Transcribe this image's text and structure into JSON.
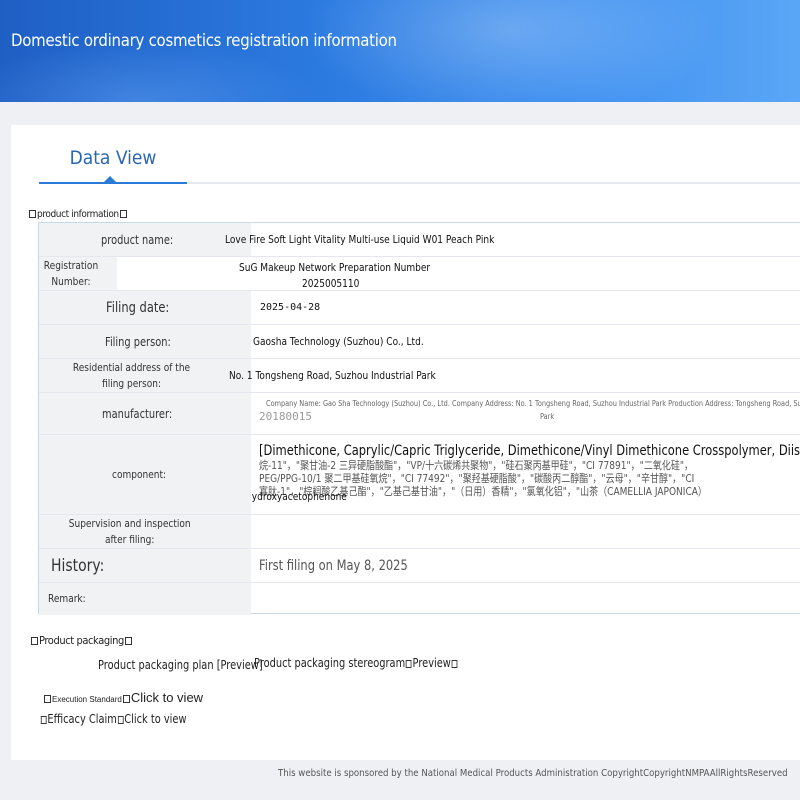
{
  "header": {
    "title": "Domestic ordinary cosmetics registration information"
  },
  "tabs": [
    {
      "label": "Data View"
    }
  ],
  "sections": {
    "product_information": "product information",
    "product_packaging": "Product packaging"
  },
  "info": {
    "product_name_label": "product name:",
    "product_name": "Love Fire Soft Light Vitality Multi-use Liquid W01 Peach Pink",
    "reg_number_label": "Registration Number:",
    "reg_number_line1": "SuG Makeup Network Preparation Number",
    "reg_number_line2": "2025005110",
    "filing_date_label": "Filing date:",
    "filing_date": "2025-04-28",
    "filing_person_label": "Filing person:",
    "filing_person": "Gaosha Technology (Suzhou) Co., Ltd.",
    "address_label": "Residential address of the filing person:",
    "address": "No. 1 Tongsheng Road, Suzhou Industrial Park",
    "manufacturer_label": "manufacturer:",
    "manufacturer_line1": "Company Name: Gao Sha Technology (Suzhou) Co., Ltd. Company Address: No. 1 Tongsheng Road, Suzhou Industrial Park Production Address: Tongsheng Road, Suzhou",
    "manufacturer_line2": "Park",
    "manufacturer_under": "20180015",
    "component_label": "component:",
    "component_line1": "[Dimethicone, Caprylic/Capric Triglyceride, Dimethicone/Vinyl Dimethicone Crosspolymer, Diisostearyl Ma",
    "component_line2": "烷-11\"，\"聚甘油-2 三异硬脂酸酯\"，\"VP/十六碳烯共聚物\"，\"硅石聚丙基甲硅\"，\"CI 77891\"，\"二氧化硅\"，",
    "component_line3": "PEG/PPG-10/1 聚二甲基硅氧烷\"，\"CI 77492\"，\"聚羟基硬脂酸\"，\"碳酸丙二醇酯\"，\"云母\"，\"辛甘醇\"，\"CI",
    "component_line4": "寡肽-1\"，\"棕榈酸乙基己酯\"，\"乙基己基甘油\"，\"（日用）香精\"，\"氯氧化铝\"，\"山茶（CAMELLIA JAPONICA）",
    "component_line5": "Hydroxyacetophenone",
    "supervision_label": "Supervision and inspection after filing:",
    "supervision": "",
    "history_label": "History:",
    "history": "First filing on May 8, 2025",
    "remark_label": "Remark:",
    "remark": ""
  },
  "packaging": {
    "plan": "Product packaging plan [Preview]",
    "stereogram_prefix": "Product packaging stereogram",
    "stereogram_link": "Preview",
    "exec_std_label": "Execution Standard",
    "exec_std_link": "Click to view",
    "efficacy_label": "Efficacy Claim",
    "efficacy_link": "Click to view"
  },
  "footer": {
    "text": "This website is sponsored by the National Medical Products Administration CopyrightCopyrightNMPAAllRightsReserved"
  },
  "colors": {
    "banner": "#2b7ae0",
    "accent": "#2a66b3",
    "label_bg": "#f1f2f4"
  }
}
